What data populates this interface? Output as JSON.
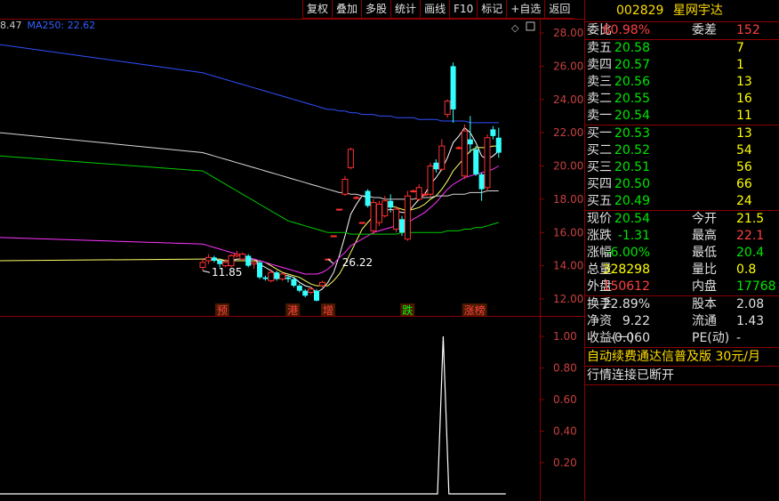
{
  "toolbar": [
    "复权",
    "叠加",
    "多股",
    "统计",
    "画线",
    "F10",
    "标记",
    "+自选",
    "返回"
  ],
  "ma_legend": [
    {
      "text": "8.47",
      "color": "#c8c8c8"
    },
    {
      "text": "MA250: 22.62",
      "color": "#3060ff"
    }
  ],
  "quote": {
    "code": "002829",
    "name": "星网宇达",
    "rows": [
      {
        "l1": "委比",
        "v1": "60.98%",
        "c1": "red",
        "l2": "委差",
        "v2": "152",
        "c2": "red",
        "sep": true
      },
      {
        "l1": "卖五",
        "v1": "20.58",
        "c1": "green",
        "l2": "",
        "v2": "7",
        "c2": "yellow"
      },
      {
        "l1": "卖四",
        "v1": "20.57",
        "c1": "green",
        "l2": "",
        "v2": "1",
        "c2": "yellow"
      },
      {
        "l1": "卖三",
        "v1": "20.56",
        "c1": "green",
        "l2": "",
        "v2": "13",
        "c2": "yellow"
      },
      {
        "l1": "卖二",
        "v1": "20.55",
        "c1": "green",
        "l2": "",
        "v2": "16",
        "c2": "yellow"
      },
      {
        "l1": "卖一",
        "v1": "20.54",
        "c1": "green",
        "l2": "",
        "v2": "11",
        "c2": "yellow",
        "sep": true
      },
      {
        "l1": "买一",
        "v1": "20.53",
        "c1": "green",
        "l2": "",
        "v2": "13",
        "c2": "yellow"
      },
      {
        "l1": "买二",
        "v1": "20.52",
        "c1": "green",
        "l2": "",
        "v2": "54",
        "c2": "yellow"
      },
      {
        "l1": "买三",
        "v1": "20.51",
        "c1": "green",
        "l2": "",
        "v2": "56",
        "c2": "yellow"
      },
      {
        "l1": "买四",
        "v1": "20.50",
        "c1": "green",
        "l2": "",
        "v2": "66",
        "c2": "yellow"
      },
      {
        "l1": "买五",
        "v1": "20.49",
        "c1": "green",
        "l2": "",
        "v2": "24",
        "c2": "yellow",
        "sep": true
      },
      {
        "l1": "现价",
        "v1": "20.54",
        "c1": "green",
        "l2": "今开",
        "v2": "21.5",
        "c2": "yellow"
      },
      {
        "l1": "涨跌",
        "v1": "-1.31",
        "c1": "green",
        "l2": "最高",
        "v2": "22.1",
        "c2": "red"
      },
      {
        "l1": "涨幅",
        "v1": "-6.00%",
        "c1": "green",
        "l2": "最低",
        "v2": "20.4",
        "c2": "green"
      },
      {
        "l1": "总量",
        "v1": "328298",
        "c1": "yellow",
        "l2": "量比",
        "v2": "0.8",
        "c2": "yellow"
      },
      {
        "l1": "外盘",
        "v1": "150612",
        "c1": "red",
        "l2": "内盘",
        "v2": "17768",
        "c2": "green",
        "sep": true
      },
      {
        "l1": "换手",
        "v1": "22.89%",
        "c1": "white",
        "l2": "股本",
        "v2": "2.08",
        "c2": "white"
      },
      {
        "l1": "净资",
        "v1": "9.22",
        "c1": "white",
        "l2": "流通",
        "v2": "1.43",
        "c2": "white"
      },
      {
        "l1": "收益(一)",
        "v1": "-0.060",
        "c1": "white",
        "l2": "PE(动)",
        "v2": "-",
        "c2": "white",
        "sep": true
      }
    ],
    "footer1": "自动续费通达信普及版  30元/月",
    "footer2": "行情连接已断开"
  },
  "chart_data": [
    {
      "type": "candlestick",
      "ylim": [
        11.0,
        29.0
      ],
      "yticks": [
        "28.00",
        "26.00",
        "24.00",
        "22.00",
        "20.00",
        "18.00",
        "16.00",
        "14.00",
        "12.00"
      ],
      "annotations": [
        {
          "text": "26.22",
          "bar": 22
        },
        {
          "text": "11.85",
          "bar": 0
        }
      ],
      "event_tags": [
        {
          "text": "预",
          "bar": 1
        },
        {
          "text": "港",
          "bar": 9
        },
        {
          "text": "增",
          "bar": 13
        },
        {
          "text": "跌",
          "bar": 22
        },
        {
          "text": "涨榜",
          "bar": 29
        }
      ],
      "candles": [
        {
          "o": 13.9,
          "c": 14.2,
          "h": 14.4,
          "l": 13.7
        },
        {
          "o": 14.3,
          "c": 14.5,
          "h": 14.7,
          "l": 14.1
        },
        {
          "o": 14.5,
          "c": 14.3,
          "h": 14.6,
          "l": 14.2
        },
        {
          "o": 14.3,
          "c": 14.1,
          "h": 14.4,
          "l": 13.9
        },
        {
          "o": 14.0,
          "c": 14.2,
          "h": 14.4,
          "l": 13.9
        },
        {
          "o": 14.0,
          "c": 14.6,
          "h": 14.7,
          "l": 13.9
        },
        {
          "o": 14.6,
          "c": 14.7,
          "h": 14.9,
          "l": 14.5
        },
        {
          "o": 14.4,
          "c": 14.7,
          "h": 14.8,
          "l": 14.3
        },
        {
          "o": 14.6,
          "c": 14.0,
          "h": 14.7,
          "l": 13.9
        },
        {
          "o": 14.1,
          "c": 14.2,
          "h": 14.3,
          "l": 13.8
        },
        {
          "o": 14.2,
          "c": 13.3,
          "h": 14.3,
          "l": 13.2
        },
        {
          "o": 13.3,
          "c": 13.2,
          "h": 13.4,
          "l": 13.1
        },
        {
          "o": 13.1,
          "c": 13.6,
          "h": 13.8,
          "l": 13.0
        },
        {
          "o": 13.6,
          "c": 13.2,
          "h": 13.7,
          "l": 13.1
        },
        {
          "o": 13.2,
          "c": 13.5,
          "h": 13.6,
          "l": 13.1
        },
        {
          "o": 13.3,
          "c": 13.2,
          "h": 13.4,
          "l": 13.0
        },
        {
          "o": 13.2,
          "c": 12.8,
          "h": 13.3,
          "l": 12.7
        },
        {
          "o": 12.8,
          "c": 12.5,
          "h": 12.9,
          "l": 12.4
        },
        {
          "o": 12.5,
          "c": 12.2,
          "h": 12.6,
          "l": 12.1
        },
        {
          "o": 12.4,
          "c": 12.6,
          "h": 12.7,
          "l": 12.3
        },
        {
          "o": 12.5,
          "c": 11.9,
          "h": 12.6,
          "l": 11.85
        },
        {
          "o": 12.8,
          "c": 13.0,
          "h": 13.1,
          "l": 12.7
        },
        {
          "o": 14.4,
          "c": 14.4,
          "h": 14.4,
          "l": 14.4
        },
        {
          "o": 15.8,
          "c": 15.8,
          "h": 15.8,
          "l": 15.8
        },
        {
          "o": 17.4,
          "c": 17.4,
          "h": 17.4,
          "l": 17.4
        },
        {
          "o": 18.3,
          "c": 19.2,
          "h": 19.4,
          "l": 18.2
        },
        {
          "o": 19.9,
          "c": 21.0,
          "h": 21.1,
          "l": 19.8
        },
        {
          "o": 18.1,
          "c": 18.1,
          "h": 18.2,
          "l": 18.0
        },
        {
          "o": 16.6,
          "c": 16.6,
          "h": 16.6,
          "l": 16.6
        },
        {
          "o": 18.5,
          "c": 17.6,
          "h": 18.6,
          "l": 17.5
        },
        {
          "o": 16.1,
          "c": 17.8,
          "h": 18.0,
          "l": 15.9
        },
        {
          "o": 16.6,
          "c": 17.7,
          "h": 17.9,
          "l": 16.4
        },
        {
          "o": 17.0,
          "c": 17.9,
          "h": 18.2,
          "l": 16.9
        },
        {
          "o": 17.9,
          "c": 17.5,
          "h": 18.3,
          "l": 17.2
        },
        {
          "o": 16.2,
          "c": 17.4,
          "h": 17.6,
          "l": 16.0
        },
        {
          "o": 16.8,
          "c": 16.0,
          "h": 17.0,
          "l": 15.8
        },
        {
          "o": 15.6,
          "c": 18.2,
          "h": 18.5,
          "l": 15.5
        },
        {
          "o": 18.5,
          "c": 18.5,
          "h": 18.6,
          "l": 18.4
        },
        {
          "o": 18.0,
          "c": 18.7,
          "h": 18.9,
          "l": 17.9
        },
        {
          "o": 18.3,
          "c": 18.3,
          "h": 18.4,
          "l": 18.2
        },
        {
          "o": 18.3,
          "c": 20.0,
          "h": 20.2,
          "l": 18.1
        },
        {
          "o": 20.2,
          "c": 19.8,
          "h": 20.4,
          "l": 19.6
        },
        {
          "o": 19.8,
          "c": 21.2,
          "h": 21.6,
          "l": 19.7
        },
        {
          "o": 23.1,
          "c": 23.9,
          "h": 24.0,
          "l": 22.9
        },
        {
          "o": 26.0,
          "c": 23.4,
          "h": 26.22,
          "l": 22.6
        },
        {
          "o": 21.1,
          "c": 21.1,
          "h": 21.2,
          "l": 21.0
        },
        {
          "o": 19.4,
          "c": 22.1,
          "h": 22.5,
          "l": 19.2
        },
        {
          "o": 21.6,
          "c": 21.3,
          "h": 23.0,
          "l": 20.8
        },
        {
          "o": 21.0,
          "c": 19.5,
          "h": 21.2,
          "l": 19.4
        },
        {
          "o": 19.5,
          "c": 18.6,
          "h": 19.6,
          "l": 17.9
        },
        {
          "o": 18.7,
          "c": 21.7,
          "h": 21.9,
          "l": 18.5
        },
        {
          "o": 22.2,
          "c": 21.8,
          "h": 22.4,
          "l": 21.6
        },
        {
          "o": 21.7,
          "c": 20.8,
          "h": 22.3,
          "l": 20.5
        }
      ],
      "ma_lines": [
        {
          "name": "MA5",
          "color": "#ffffff",
          "values": [
            14.4,
            14.4,
            14.4,
            14.3,
            14.3,
            14.3,
            14.4,
            14.4,
            14.4,
            14.4,
            14.1,
            13.9,
            13.7,
            13.5,
            13.4,
            13.4,
            13.3,
            13.0,
            12.8,
            12.7,
            12.4,
            12.6,
            13.0,
            13.6,
            14.6,
            15.8,
            17.1,
            17.7,
            18.2,
            18.1,
            17.5,
            17.2,
            17.3,
            17.4,
            17.3,
            17.2,
            17.2,
            17.6,
            18.0,
            18.3,
            18.9,
            19.3,
            19.8,
            20.5,
            21.4,
            21.8,
            22.3,
            22.0,
            21.4,
            20.6,
            20.4,
            20.6,
            20.9
          ]
        },
        {
          "name": "MA10",
          "color": "#ffff66",
          "values": [
            14.4,
            14.4,
            14.4,
            14.4,
            14.3,
            14.3,
            14.3,
            14.3,
            14.3,
            14.3,
            14.3,
            14.2,
            14.0,
            13.8,
            13.6,
            13.5,
            13.4,
            13.3,
            13.1,
            12.9,
            12.8,
            12.8,
            12.8,
            13.1,
            13.5,
            14.1,
            14.8,
            15.5,
            16.2,
            16.6,
            17.0,
            17.3,
            17.5,
            17.6,
            17.5,
            17.4,
            17.3,
            17.4,
            17.5,
            17.7,
            18.0,
            18.2,
            18.6,
            19.1,
            19.7,
            20.1,
            20.5,
            20.9,
            21.1,
            21.1,
            21.1,
            21.2,
            21.2
          ]
        },
        {
          "name": "MA30",
          "color": "#ff33ff",
          "values": [
            15.3,
            15.2,
            15.1,
            15.0,
            14.9,
            14.8,
            14.7,
            14.6,
            14.5,
            14.4,
            14.3,
            14.2,
            14.1,
            14.0,
            13.9,
            13.8,
            13.7,
            13.6,
            13.5,
            13.5,
            13.5,
            13.6,
            13.8,
            14.1,
            14.5,
            14.8,
            15.2,
            15.4,
            15.6,
            15.8,
            16.0,
            16.1,
            16.2,
            16.3,
            16.4,
            16.5,
            16.6,
            16.8,
            17.0,
            17.2,
            17.5,
            17.8,
            18.2,
            18.6,
            18.9,
            19.1,
            19.3,
            19.4,
            19.5,
            19.6,
            19.7,
            19.8,
            20.0
          ]
        },
        {
          "name": "MA60",
          "color": "#00cc00",
          "values": [
            19.7,
            19.5,
            19.3,
            19.1,
            18.9,
            18.7,
            18.5,
            18.3,
            18.1,
            17.9,
            17.7,
            17.5,
            17.3,
            17.1,
            16.9,
            16.7,
            16.6,
            16.5,
            16.4,
            16.3,
            16.2,
            16.1,
            16.0,
            16.0,
            16.0,
            16.0,
            15.9,
            15.9,
            15.9,
            15.9,
            15.9,
            15.9,
            15.9,
            15.9,
            15.9,
            16.0,
            16.0,
            16.0,
            16.0,
            16.0,
            16.0,
            16.0,
            16.0,
            16.1,
            16.1,
            16.1,
            16.2,
            16.2,
            16.3,
            16.3,
            16.4,
            16.5,
            16.6
          ]
        },
        {
          "name": "MA120",
          "color": "#d8d8d8",
          "values": [
            20.8,
            20.7,
            20.6,
            20.5,
            20.4,
            20.3,
            20.2,
            20.1,
            20.0,
            19.9,
            19.8,
            19.7,
            19.6,
            19.5,
            19.4,
            19.3,
            19.2,
            19.1,
            19.0,
            18.9,
            18.8,
            18.7,
            18.6,
            18.5,
            18.4,
            18.4,
            18.3,
            18.3,
            18.2,
            18.2,
            18.1,
            18.1,
            18.0,
            18.0,
            18.0,
            18.0,
            18.0,
            18.0,
            18.1,
            18.1,
            18.1,
            18.2,
            18.2,
            18.2,
            18.3,
            18.3,
            18.3,
            18.4,
            18.4,
            18.4,
            18.5,
            18.5,
            18.5
          ]
        },
        {
          "name": "MA250",
          "color": "#3050ff",
          "values": [
            25.6,
            25.5,
            25.4,
            25.3,
            25.2,
            25.1,
            25.0,
            24.9,
            24.8,
            24.7,
            24.6,
            24.5,
            24.4,
            24.3,
            24.2,
            24.1,
            24.0,
            23.9,
            23.8,
            23.7,
            23.6,
            23.5,
            23.4,
            23.4,
            23.3,
            23.3,
            23.2,
            23.2,
            23.1,
            23.1,
            23.1,
            23.0,
            23.0,
            23.0,
            22.9,
            22.9,
            22.9,
            22.9,
            22.8,
            22.8,
            22.8,
            22.8,
            22.7,
            22.7,
            22.7,
            22.7,
            22.7,
            22.6,
            22.6,
            22.6,
            22.6,
            22.6,
            22.6
          ]
        }
      ]
    },
    {
      "type": "line",
      "ylim": [
        0,
        1.0
      ],
      "yticks": [
        "1.00",
        "0.80",
        "0.60",
        "0.40",
        "0.20"
      ],
      "values": [
        0,
        0,
        0,
        0,
        0,
        0,
        0,
        0,
        0,
        0,
        0,
        0,
        0,
        0,
        0,
        0,
        0,
        0,
        0,
        0,
        0,
        0,
        0,
        0,
        0,
        0,
        0,
        0,
        0,
        0,
        0,
        0,
        0,
        0,
        0,
        0,
        0,
        0,
        0,
        0,
        0,
        1,
        0,
        0,
        0,
        0,
        0,
        0,
        0,
        0,
        0,
        0,
        0
      ],
      "color": "#ffffff"
    }
  ]
}
